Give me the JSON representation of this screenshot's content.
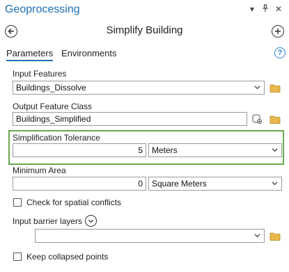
{
  "pane": {
    "title": "Geoprocessing",
    "controls": {
      "menu": "▾",
      "pin": "⊥",
      "close": "✕"
    }
  },
  "tool": {
    "title": "Simplify Building"
  },
  "tabs": [
    {
      "label": "Parameters",
      "active": true
    },
    {
      "label": "Environments",
      "active": false
    }
  ],
  "params": {
    "input_features": {
      "label": "Input Features",
      "value": "Buildings_Dissolve"
    },
    "output_feature_class": {
      "label": "Output Feature Class",
      "value": "Buildings_Simplified"
    },
    "simplification_tolerance": {
      "label": "Simplification Tolerance",
      "value": "5",
      "unit": "Meters"
    },
    "minimum_area": {
      "label": "Minimum Area",
      "value": "0",
      "unit": "Square Meters"
    },
    "check_spatial_conflicts": {
      "label": "Check for spatial conflicts",
      "checked": false
    },
    "input_barrier_layers": {
      "label": "Input barrier layers",
      "value": ""
    },
    "keep_collapsed_points": {
      "label": "Keep collapsed points",
      "checked": false
    }
  },
  "colors": {
    "accent": "#1d6fb5",
    "highlight": "#6aa84f",
    "folder": "#e8b84a"
  }
}
